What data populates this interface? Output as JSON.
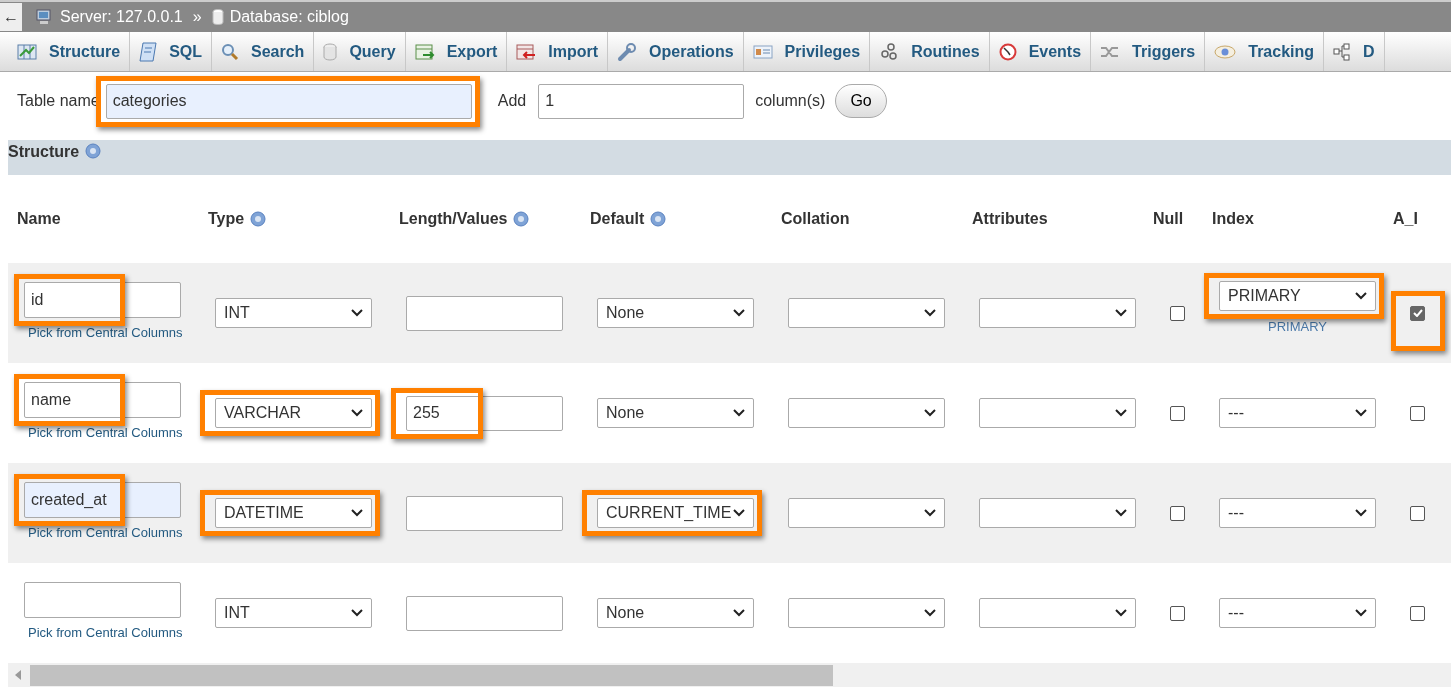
{
  "breadcrumb": {
    "back": "←",
    "server": "Server: 127.0.0.1",
    "separator": "»",
    "database": "Database: ciblog"
  },
  "tabs": [
    {
      "label": "Structure",
      "selected": false
    },
    {
      "label": "SQL",
      "selected": false
    },
    {
      "label": "Search",
      "selected": false
    },
    {
      "label": "Query",
      "selected": false
    },
    {
      "label": "Export",
      "selected": false
    },
    {
      "label": "Import",
      "selected": false
    },
    {
      "label": "Operations",
      "selected": false
    },
    {
      "label": "Privileges",
      "selected": false
    },
    {
      "label": "Routines",
      "selected": false
    },
    {
      "label": "Events",
      "selected": false
    },
    {
      "label": "Triggers",
      "selected": false
    },
    {
      "label": "Tracking",
      "selected": false
    },
    {
      "label": "D",
      "selected": false
    }
  ],
  "table_form": {
    "table_name_label": "Table name",
    "table_name": "categories",
    "table_name_highlighted": true,
    "add_label": "Add",
    "add_value": "1",
    "columns_label": "column(s)",
    "go_button": "Go"
  },
  "structure": {
    "title": "Structure",
    "columns": [
      {
        "label": "Name",
        "help": false
      },
      {
        "label": "Type",
        "help": true
      },
      {
        "label": "Length/Values",
        "help": true
      },
      {
        "label": "Default",
        "help": true
      },
      {
        "label": "Collation",
        "help": false
      },
      {
        "label": "Attributes",
        "help": false
      },
      {
        "label": "Null",
        "help": false
      },
      {
        "label": "Index",
        "help": false
      },
      {
        "label": "A_I",
        "help": false
      }
    ],
    "rows": [
      {
        "name": "id",
        "name_highlighted": true,
        "name_filled": false,
        "central_columns_link": "Pick from Central Columns",
        "type": "INT",
        "type_highlighted": false,
        "length_highlighted": false,
        "default": "None",
        "default_highlighted": false,
        "null": false,
        "index": "PRIMARY",
        "index_highlighted": true,
        "index_note": "PRIMARY",
        "ai": true,
        "ai_highlighted": true
      },
      {
        "name": "name",
        "name_highlighted": true,
        "name_filled": false,
        "central_columns_link": "Pick from Central Columns",
        "type": "VARCHAR",
        "type_highlighted": true,
        "length": "255",
        "length_highlighted": true,
        "default": "None",
        "default_highlighted": false,
        "null": false,
        "index": "---",
        "index_highlighted": false,
        "ai": false,
        "ai_highlighted": false
      },
      {
        "name": "created_at",
        "name_highlighted": true,
        "name_filled": true,
        "central_columns_link": "Pick from Central Columns",
        "type": "DATETIME",
        "type_highlighted": true,
        "length_highlighted": false,
        "default": "CURRENT_TIME",
        "default_highlighted": true,
        "null": false,
        "index": "---",
        "index_highlighted": false,
        "ai": false,
        "ai_highlighted": false
      },
      {
        "name_highlighted": false,
        "name_filled": false,
        "central_columns_link": "Pick from Central Columns",
        "type": "INT",
        "type_highlighted": false,
        "length_highlighted": false,
        "default": "None",
        "default_highlighted": false,
        "null": false,
        "index": "---",
        "index_highlighted": false,
        "ai": false,
        "ai_highlighted": false
      }
    ]
  }
}
